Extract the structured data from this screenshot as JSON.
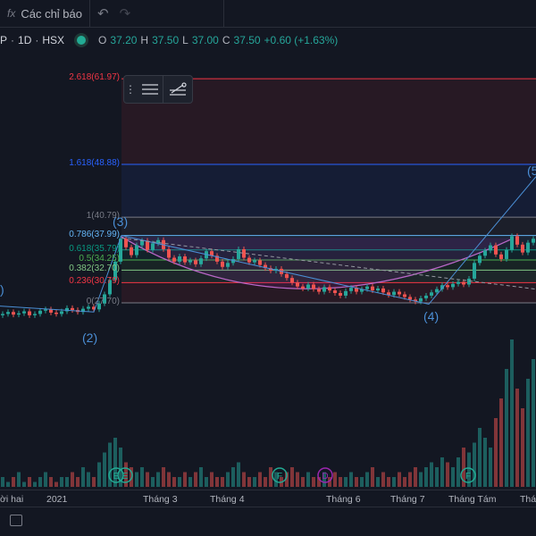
{
  "toolbar": {
    "indicators_label": "Các chỉ báo",
    "fx_icon": "fx",
    "undo": "undo-icon",
    "redo": "redo-icon"
  },
  "legend": {
    "symbol_tail": "P",
    "interval": "1D",
    "exchange": "HSX",
    "sep": "·",
    "open_label": "O",
    "open": "37.20",
    "high_label": "H",
    "high": "37.50",
    "low_label": "L",
    "low": "37.00",
    "close_label": "C",
    "close": "37.50",
    "change": "+0.60 (+1.63%)"
  },
  "fib_levels": [
    {
      "label": "2.618(61.97)",
      "ratio": 2.618,
      "price": 61.97,
      "color": "#f23645"
    },
    {
      "label": "1.618(48.88)",
      "ratio": 1.618,
      "price": 48.88,
      "color": "#2962ff"
    },
    {
      "label": "1(40.79)",
      "ratio": 1,
      "price": 40.79,
      "color": "#787b86"
    },
    {
      "label": "0.786(37.99)",
      "ratio": 0.786,
      "price": 37.99,
      "color": "#64b5f6"
    },
    {
      "label": "0.618(35.79)",
      "ratio": 0.618,
      "price": 35.79,
      "color": "#089981"
    },
    {
      "label": "0.5(34.25)",
      "ratio": 0.5,
      "price": 34.25,
      "color": "#4caf50"
    },
    {
      "label": "0.382(32.70)",
      "ratio": 0.382,
      "price": 32.7,
      "color": "#81c784"
    },
    {
      "label": "0.236(30.79)",
      "ratio": 0.236,
      "price": 30.79,
      "color": "#f23645"
    },
    {
      "label": "0(27.70)",
      "ratio": 0,
      "price": 27.7,
      "color": "#787b86"
    }
  ],
  "waves": [
    ")",
    "(2)",
    "(3)",
    "(4)",
    "(5"
  ],
  "events": [
    {
      "t": "E",
      "color": "#22ab94"
    },
    {
      "t": "E",
      "color": "#22ab94"
    },
    {
      "t": "F",
      "color": "#22ab94"
    },
    {
      "t": "D",
      "color": "#9c27b0"
    },
    {
      "t": "F",
      "color": "#22ab94"
    }
  ],
  "time_axis": [
    "ời hai",
    "2021",
    "Tháng 3",
    "Tháng 4",
    "Tháng 6",
    "Tháng 7",
    "Tháng Tám",
    "Thán"
  ],
  "prices": [
    26.0,
    26.3,
    25.9,
    26.1,
    26.4,
    25.8,
    26.0,
    26.5,
    26.7,
    26.2,
    26.0,
    26.4,
    26.9,
    26.6,
    26.3,
    26.8,
    27.1,
    26.7,
    27.6,
    29.0,
    31.2,
    34.0,
    37.5,
    36.2,
    35.0,
    36.5,
    37.2,
    35.8,
    36.8,
    37.3,
    35.9,
    34.6,
    34.0,
    34.8,
    33.9,
    34.2,
    33.6,
    34.5,
    35.6,
    34.9,
    34.0,
    33.2,
    33.8,
    34.4,
    35.9,
    34.6,
    33.9,
    34.2,
    33.5,
    33.0,
    32.6,
    32.9,
    32.1,
    31.5,
    30.8,
    30.2,
    29.9,
    30.5,
    29.8,
    29.4,
    30.1,
    29.6,
    29.2,
    28.8,
    29.5,
    30.0,
    29.4,
    29.8,
    30.2,
    29.6,
    29.9,
    29.3,
    28.9,
    29.4,
    29.0,
    28.6,
    28.2,
    27.9,
    28.4,
    28.8,
    29.3,
    29.8,
    30.4,
    30.1,
    30.6,
    30.9,
    30.5,
    31.4,
    33.8,
    34.9,
    35.7,
    36.5,
    35.1,
    34.4,
    35.8,
    37.9,
    36.6,
    35.4,
    36.9,
    37.5
  ],
  "volumes": [
    2,
    1,
    2,
    3,
    1,
    2,
    1,
    2,
    3,
    2,
    1,
    2,
    2,
    3,
    2,
    4,
    3,
    2,
    5,
    7,
    9,
    10,
    8,
    5,
    4,
    3,
    4,
    3,
    2,
    3,
    4,
    3,
    2,
    2,
    3,
    2,
    3,
    4,
    2,
    3,
    2,
    2,
    3,
    4,
    5,
    3,
    2,
    2,
    3,
    2,
    4,
    3,
    2,
    3,
    4,
    3,
    2,
    3,
    2,
    2,
    3,
    2,
    3,
    2,
    2,
    3,
    2,
    2,
    3,
    4,
    2,
    3,
    2,
    2,
    3,
    2,
    3,
    4,
    3,
    4,
    5,
    4,
    6,
    5,
    4,
    6,
    8,
    7,
    9,
    12,
    10,
    8,
    14,
    18,
    24,
    30,
    20,
    16,
    22,
    26
  ]
}
